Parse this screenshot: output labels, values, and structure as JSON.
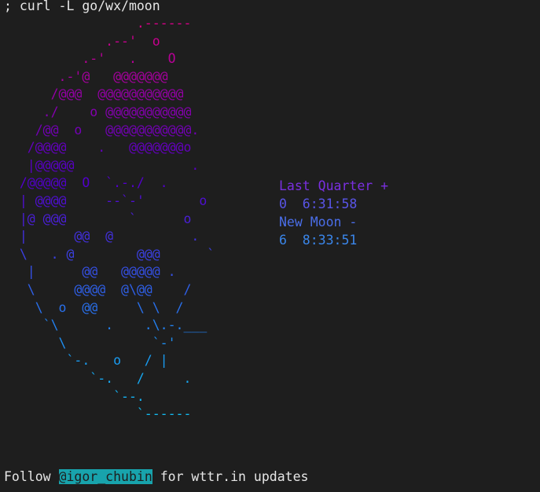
{
  "terminal": {
    "command": "; curl -L go/wx/moon"
  },
  "moon_art": {
    "lines": [
      "                 .------",
      "             .--'  o     ",
      "          .-'   .    O   ",
      "       .-'@   @@@@@@@    ",
      "      /@@@  @@@@@@@@@@@  ",
      "     ./    o @@@@@@@@@@@ ",
      "    /@@  o   @@@@@@@@@@@.",
      "   /@@@@    .   @@@@@@@o ",
      "   |@@@@@               .",
      "  /@@@@@  O  `.-./  .    ",
      "  | @@@@     --`-'       o",
      "  |@ @@@        `      o ",
      "  |      @@  @          .",
      "  \\   . @        @@@      `",
      "   |      @@   @@@@@ .   ",
      "   \\     @@@@  @\\@@    / ",
      "    \\  o  @@     \\ \\  /  ",
      "     `\\      .    .\\.-.___",
      "       \\           `-'   ",
      "        `-.   o   / |    ",
      "           `-.   /     .  ",
      "              `--.       ",
      "                 `------"
    ],
    "colors": [
      "#d70087",
      "#c8008f",
      "#b70096",
      "#a6009e",
      "#9500a6",
      "#8400ae",
      "#7300b5",
      "#6300bd",
      "#5900c4",
      "#5200cb",
      "#4f0fd2",
      "#4a1fd8",
      "#4230de",
      "#3b40e2",
      "#3550e6",
      "#2f60e9",
      "#2970ec",
      "#2380ef",
      "#1e8ef1",
      "#199cf2",
      "#16a8f2",
      "#14b2f2",
      "#12baf0"
    ]
  },
  "phases": [
    {
      "text": "Last Quarter +",
      "color": "#7a2fe0"
    },
    {
      "text": "0  6:31:58",
      "color": "#5a55e8"
    },
    {
      "text": "New Moon -",
      "color": "#4a6ee8"
    },
    {
      "text": "6  8:33:51",
      "color": "#3a86ea"
    }
  ],
  "footer": {
    "prefix": "Follow ",
    "handle": "@igor_chubin",
    "suffix": " for wttr.in updates"
  }
}
